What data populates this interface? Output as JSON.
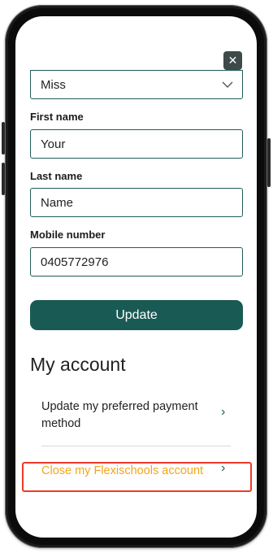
{
  "close_label": "✕",
  "form": {
    "title_value": "Miss",
    "first_name_label": "First name",
    "first_name_value": "Your",
    "last_name_label": "Last name",
    "last_name_value": "Name",
    "mobile_label": "Mobile number",
    "mobile_value": "0405772976",
    "update_label": "Update"
  },
  "account": {
    "heading": "My account",
    "items": [
      {
        "label": "Update my preferred payment method",
        "chevron": "›"
      },
      {
        "label": "Close my Flexischools account",
        "chevron": "›"
      }
    ]
  },
  "colors": {
    "accent": "#1a5a55",
    "link_orange": "#f2a51a",
    "highlight": "#ee3b2a"
  }
}
